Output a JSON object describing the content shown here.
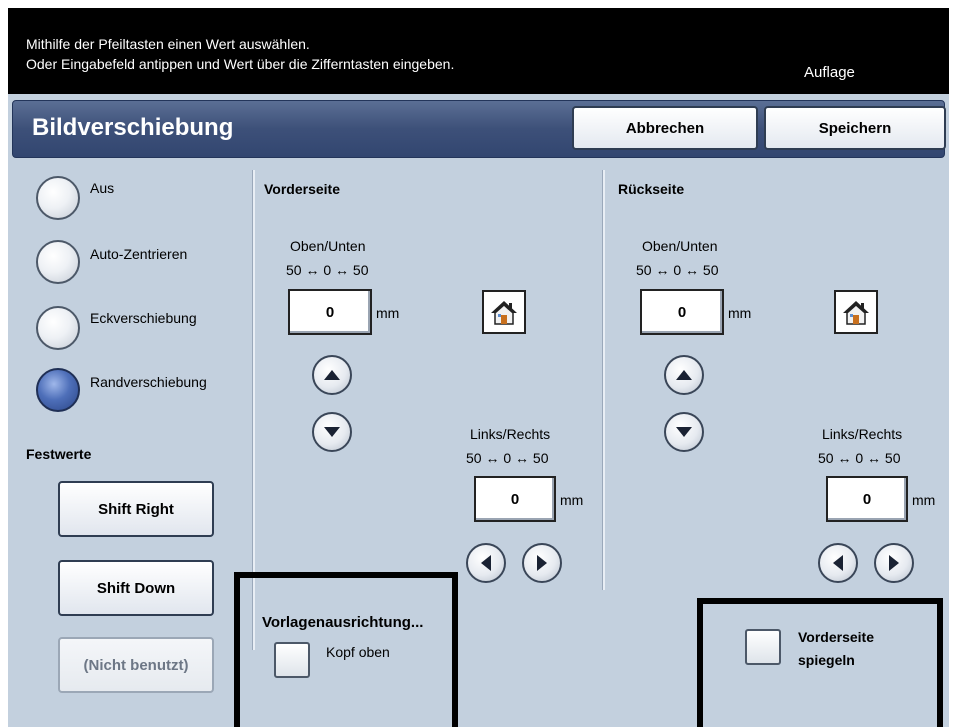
{
  "top_bar": {
    "hint_line1": "Mithilfe der Pfeiltasten einen Wert auswählen.",
    "hint_line2": "Oder Eingabefeld antippen und Wert über die Zifferntasten eingeben.",
    "quantity_label": "Auflage"
  },
  "header": {
    "title": "Bildverschiebung",
    "cancel_label": "Abbrechen",
    "save_label": "Speichern"
  },
  "mode_options": [
    {
      "label": "Aus",
      "selected": false
    },
    {
      "label": "Auto-Zentrieren",
      "selected": false
    },
    {
      "label": "Eckverschiebung",
      "selected": false
    },
    {
      "label": "Randverschiebung",
      "selected": true
    }
  ],
  "presets": {
    "heading": "Festwerte",
    "items": [
      {
        "label": "Shift Right",
        "enabled": true
      },
      {
        "label": "Shift Down",
        "enabled": true
      },
      {
        "label": "(Nicht benutzt)",
        "enabled": false
      }
    ]
  },
  "front": {
    "heading": "Vorderseite",
    "up_down_label": "Oben/Unten",
    "up_down_range": "50 ↔ 0 ↔ 50",
    "up_down_value": "0",
    "left_right_label": "Links/Rechts",
    "left_right_range": "50 ↔ 0 ↔ 50",
    "left_right_value": "0",
    "unit": "mm"
  },
  "back": {
    "heading": "Rückseite",
    "up_down_label": "Oben/Unten",
    "up_down_range": "50 ↔ 0 ↔ 50",
    "up_down_value": "0",
    "left_right_label": "Links/Rechts",
    "left_right_range": "50 ↔ 0 ↔ 50",
    "left_right_value": "0",
    "unit": "mm"
  },
  "orientation": {
    "heading": "Vorlagenausrichtung...",
    "option_label": "Kopf oben"
  },
  "mirror": {
    "label_line1": "Vorderseite",
    "label_line2": "spiegeln"
  },
  "icons": {
    "home": "home-icon",
    "up": "arrow-up-icon",
    "down": "arrow-down-icon",
    "left": "arrow-left-icon",
    "right": "arrow-right-icon"
  },
  "colors": {
    "header_blue": "#3d5079",
    "panel_bg": "#c3d0de",
    "selected_radio": "#4e6fb9"
  }
}
